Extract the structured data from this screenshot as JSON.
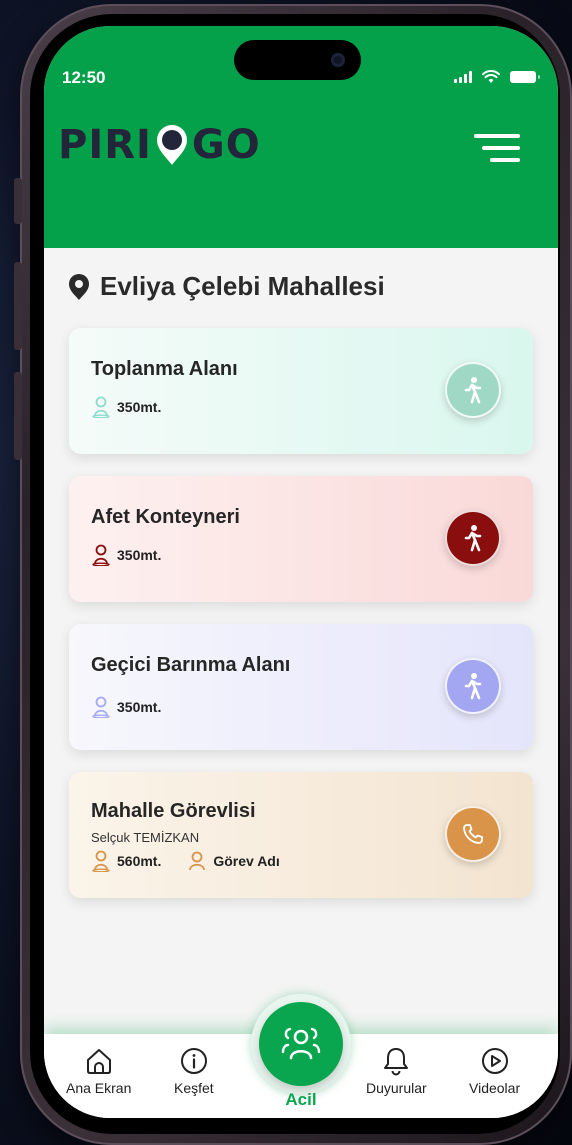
{
  "status_bar": {
    "time": "12:50"
  },
  "header": {
    "logo_text_left": "PIRI",
    "logo_text_right": "GO"
  },
  "location": {
    "title": "Evliya Çelebi Mahallesi"
  },
  "cards": [
    {
      "title": "Toplanma Alanı",
      "distance": "350mt.",
      "accent": "#8fdccb",
      "icon_color": "#9fd9c6",
      "action_icon": "walking-person-icon"
    },
    {
      "title": "Afet Konteyneri",
      "distance": "350mt.",
      "accent": "#8b0e0e",
      "icon_color": "#8b0e0e",
      "action_icon": "walking-person-icon"
    },
    {
      "title": "Geçici Barınma Alanı",
      "distance": "350mt.",
      "accent": "#a6a9f5",
      "icon_color": "#a3a6f0",
      "action_icon": "walking-person-icon"
    },
    {
      "title": "Mahalle Görevlisi",
      "subtitle": "Selçuk TEMİZKAN",
      "distance": "560mt.",
      "role": "Görev Adı",
      "accent": "#d9944a",
      "icon_color": "#d9944a",
      "action_icon": "phone-icon"
    }
  ],
  "nav": {
    "home": "Ana Ekran",
    "explore": "Keşfet",
    "emergency": "Acil",
    "announcements": "Duyurular",
    "videos": "Videolar"
  },
  "colors": {
    "brand_green": "#04a04a",
    "logo_dark": "#23263a"
  }
}
